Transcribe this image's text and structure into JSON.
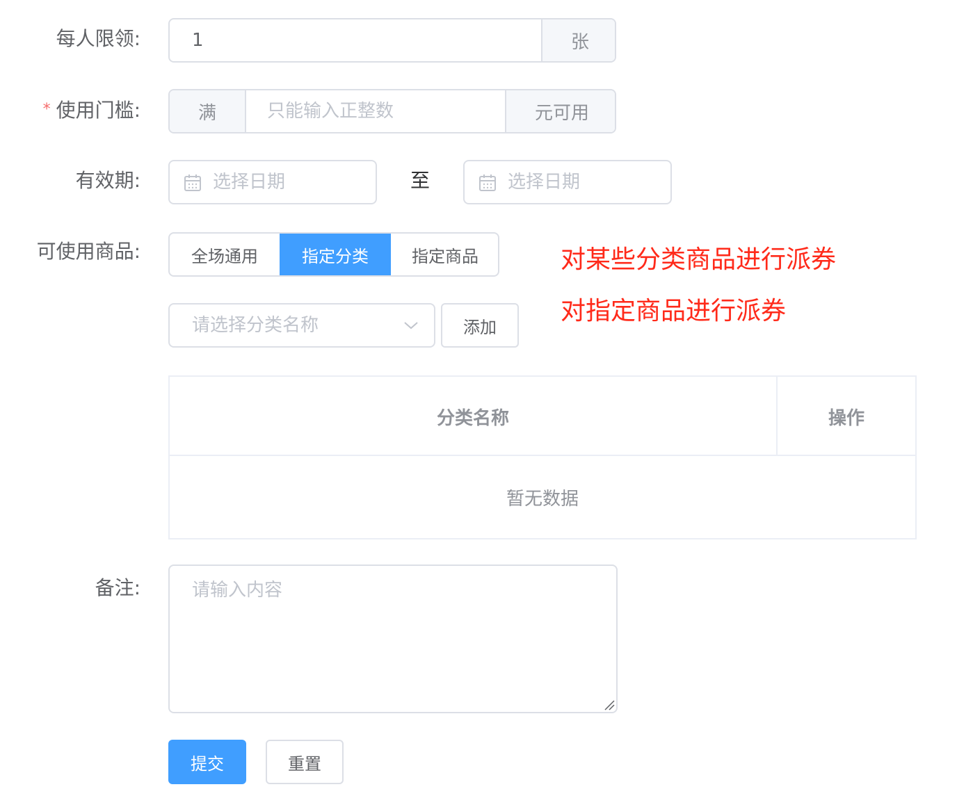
{
  "per_person_limit": {
    "label": "每人限领:",
    "value": "1",
    "unit": "张"
  },
  "threshold": {
    "required_mark": "*",
    "label": "使用门槛:",
    "prefix": "满",
    "placeholder": "只能输入正整数",
    "suffix": "元可用"
  },
  "validity": {
    "label": "有效期:",
    "start_placeholder": "选择日期",
    "separator": "至",
    "end_placeholder": "选择日期"
  },
  "goods_scope": {
    "label": "可使用商品:",
    "options": [
      "全场通用",
      "指定分类",
      "指定商品"
    ],
    "selected": "指定分类",
    "category_select_placeholder": "请选择分类名称",
    "add_button": "添加"
  },
  "annotations": {
    "line1": "对某些分类商品进行派券",
    "line2": "对指定商品进行派券",
    "color": "#ff2a1a"
  },
  "category_table": {
    "columns": [
      "分类名称",
      "操作"
    ],
    "empty_text": "暂无数据"
  },
  "remarks": {
    "label": "备注:",
    "placeholder": "请输入内容"
  },
  "actions": {
    "submit": "提交",
    "reset": "重置"
  },
  "colors": {
    "primary": "#409eff",
    "border": "#dcdfe6",
    "addon_bg": "#f5f7fa",
    "required": "#f56c6c"
  }
}
